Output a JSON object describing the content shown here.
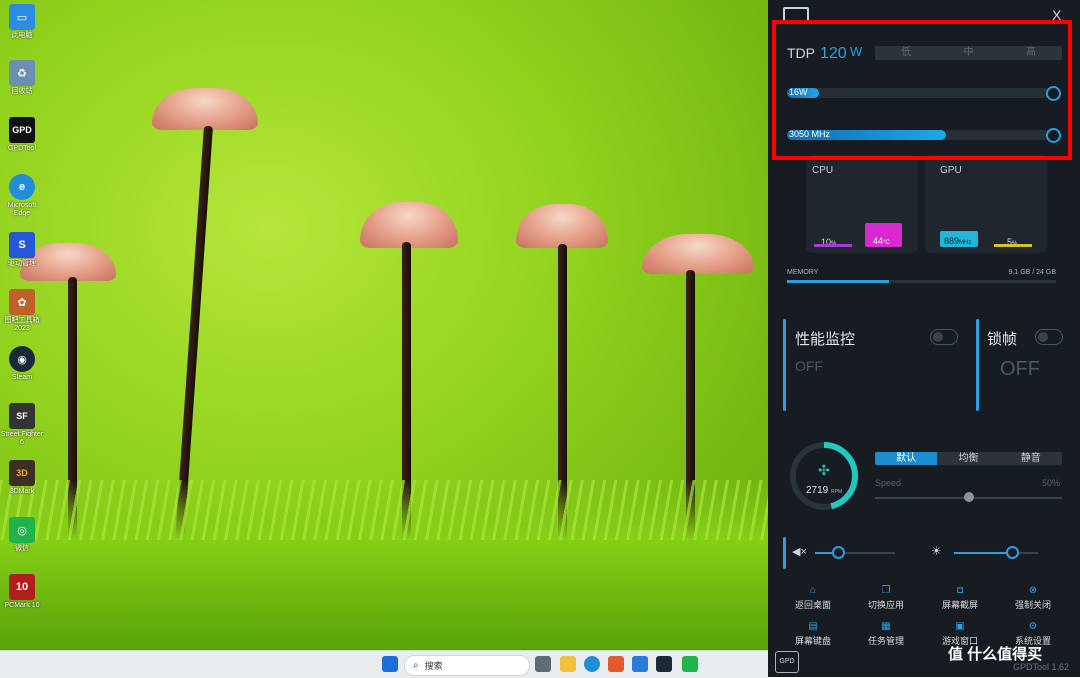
{
  "desktop": {
    "icons": [
      {
        "label": "此电脑",
        "color": "#2b8de0",
        "glyph": "▭"
      },
      {
        "label": "回收站",
        "color": "#6a8fb0",
        "glyph": "♻"
      },
      {
        "label": "GPDTool",
        "color": "#111111",
        "glyph": "GPD"
      },
      {
        "label": "Microsoft Edge",
        "color": "#1f8fd8",
        "glyph": "e"
      },
      {
        "label": "驱动管理",
        "color": "#2458d8",
        "glyph": "S"
      },
      {
        "label": "图吧工具箱2023",
        "color": "#c0602a",
        "glyph": "✿"
      },
      {
        "label": "Steam",
        "color": "#1b2838",
        "glyph": "◉"
      },
      {
        "label": "Street Fighter 6",
        "color": "#333333",
        "glyph": "SF"
      },
      {
        "label": "3DMark",
        "color": "#3a2f20",
        "glyph": "3D"
      },
      {
        "label": "微信",
        "color": "#20b34a",
        "glyph": "◎"
      },
      {
        "label": "PCMark 10",
        "color": "#b21e1e",
        "glyph": "10"
      }
    ]
  },
  "taskbar": {
    "search_placeholder": "搜索",
    "icons": [
      "windows-start-icon",
      "search-icon",
      "task-view-icon",
      "file-explorer-icon",
      "edge-icon",
      "store-icon",
      "photos-icon",
      "steam-icon",
      "wechat-icon"
    ]
  },
  "panel": {
    "close_label": "X",
    "tdp": {
      "label": "TDP",
      "value": "120",
      "unit": "W",
      "modes": [
        "低",
        "中",
        "高"
      ],
      "power_slider": {
        "label": "16W",
        "level": 0.12
      },
      "clock_slider": {
        "label": "3050 MHz",
        "level": 0.6
      }
    },
    "cpu": {
      "label": "CPU",
      "usage": "10",
      "usage_unit": "%",
      "temp": "44",
      "temp_unit": "°C"
    },
    "gpu": {
      "label": "GPU",
      "clock": "889",
      "clock_unit": "MHz",
      "usage": "5",
      "usage_unit": "%"
    },
    "memory": {
      "label": "MEMORY",
      "value": "9.1 GB / 24 GB",
      "level": 0.38
    },
    "monitor": {
      "label": "性能监控",
      "state": "OFF"
    },
    "framelock": {
      "label": "锁帧",
      "state": "OFF"
    },
    "fan": {
      "rpm": "2719",
      "rpm_unit": "RPM",
      "modes": [
        "默认",
        "均衡",
        "静音"
      ],
      "speed_label": "Speed",
      "speed_value": "50%",
      "speed_level": 0.5
    },
    "volume_level": 0.28,
    "brightness_level": 0.68,
    "tiles": [
      "返回桌面",
      "切换应用",
      "屏幕截屏",
      "强制关闭",
      "屏幕键盘",
      "任务管理",
      "游戏窗口",
      "系统设置"
    ],
    "footer": {
      "version": "GPDTool 1.62",
      "watermark": "值 什么值得买"
    },
    "colors": {
      "accent": "#2d9ee0",
      "highlight": "#ff0000"
    }
  }
}
